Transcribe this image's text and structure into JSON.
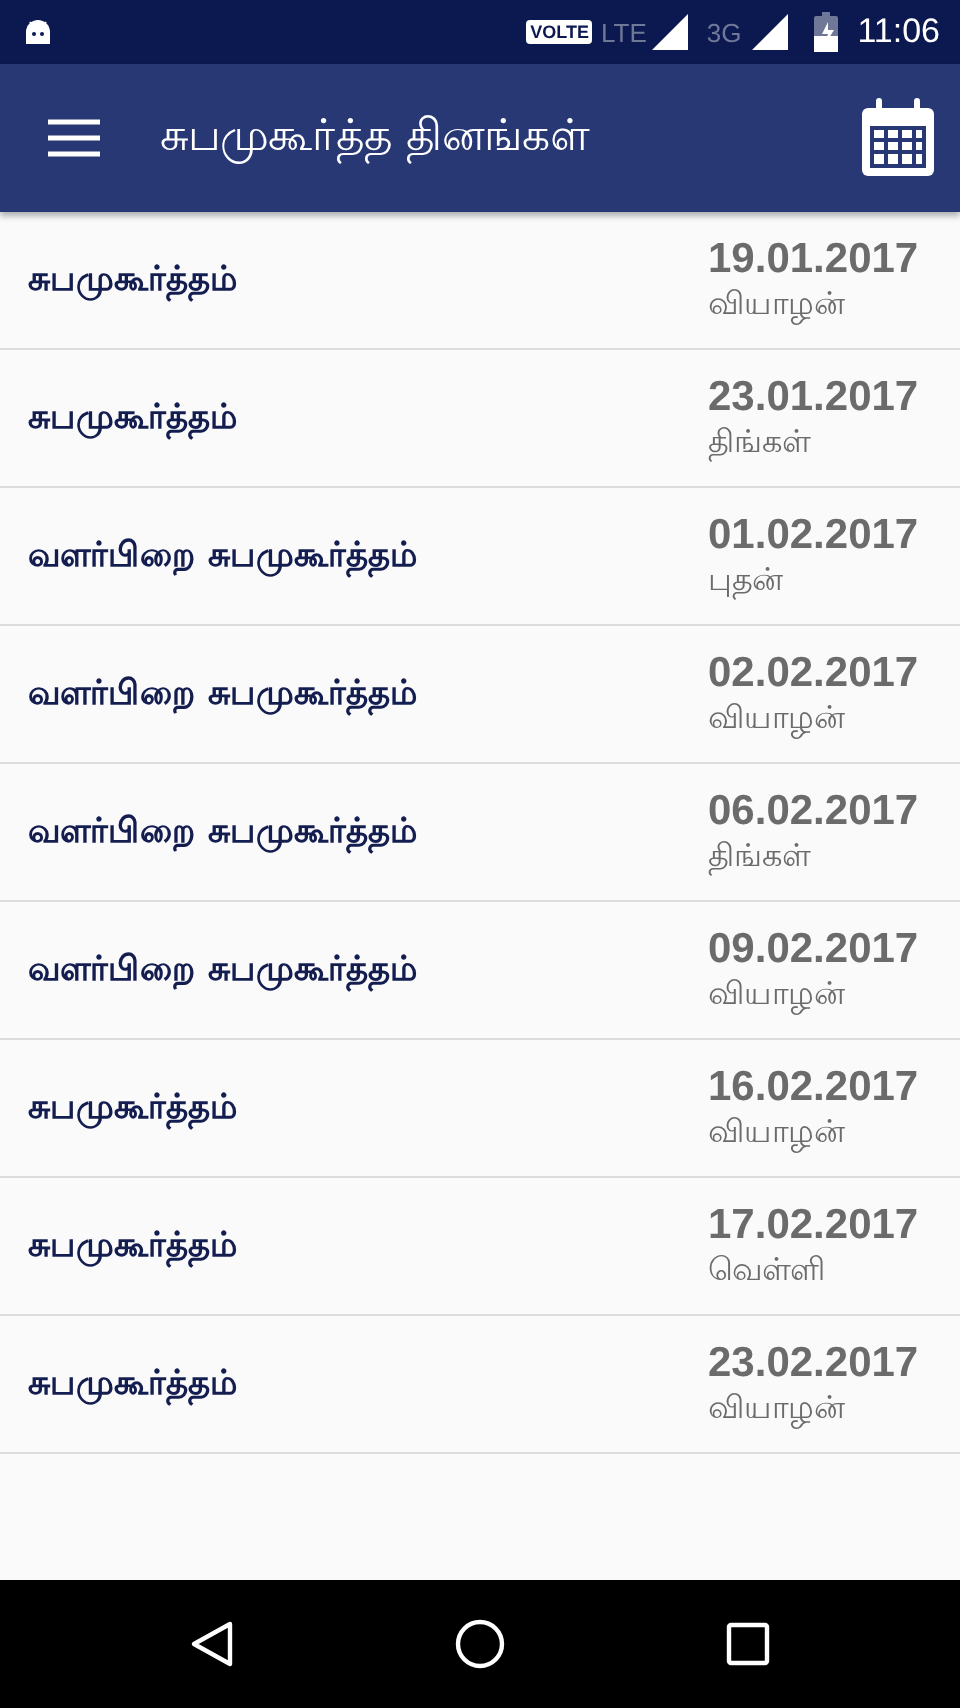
{
  "status_bar": {
    "volte": "VOLTE",
    "lte": "LTE",
    "network": "3G",
    "time": "11:06"
  },
  "app_bar": {
    "title": "சுபமுகூர்த்த தினங்கள்"
  },
  "rows": [
    {
      "title": "சுபமுகூர்த்தம்",
      "date": "19.01.2017",
      "day": "வியாழன்"
    },
    {
      "title": "சுபமுகூர்த்தம்",
      "date": "23.01.2017",
      "day": "திங்கள்"
    },
    {
      "title": "வளர்பிறை சுபமுகூர்த்தம்",
      "date": "01.02.2017",
      "day": "புதன்"
    },
    {
      "title": "வளர்பிறை சுபமுகூர்த்தம்",
      "date": "02.02.2017",
      "day": "வியாழன்"
    },
    {
      "title": "வளர்பிறை சுபமுகூர்த்தம்",
      "date": "06.02.2017",
      "day": "திங்கள்"
    },
    {
      "title": "வளர்பிறை சுபமுகூர்த்தம்",
      "date": "09.02.2017",
      "day": "வியாழன்"
    },
    {
      "title": "சுபமுகூர்த்தம்",
      "date": "16.02.2017",
      "day": "வியாழன்"
    },
    {
      "title": "சுபமுகூர்த்தம்",
      "date": "17.02.2017",
      "day": "வெள்ளி"
    },
    {
      "title": "சுபமுகூர்த்தம்",
      "date": "23.02.2017",
      "day": "வியாழன்"
    }
  ]
}
